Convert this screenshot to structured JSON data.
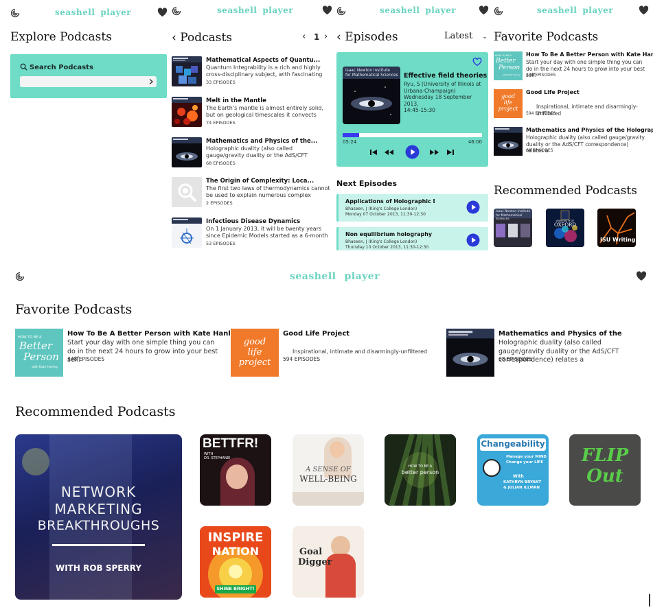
{
  "brand": {
    "part1": "seashell",
    "part2": "player"
  },
  "explore": {
    "title": "Explore Podcasts",
    "search_label": "Search Podcasts",
    "search_placeholder": ""
  },
  "podcasts": {
    "title": "Podcasts",
    "page": "1",
    "items": [
      {
        "title": "Mathematical Aspects of Quantu...",
        "desc": "Quantum Integrability is a rich and highly cross-disciplinary subject, with fascinating",
        "episodes": "33 EPISODES"
      },
      {
        "title": "Melt in the Mantle",
        "desc": "The Earth's mantle is almost entirely solid, but on geological timescales it convects vigorously, the",
        "episodes": "74 EPISODES"
      },
      {
        "title": "Mathematics and Physics of the...",
        "desc": "Holographic duality (also called gauge/gravity duality or the AdS/CFT correspondence) relates a",
        "episodes": "68 EPISODES"
      },
      {
        "title": "The Origin of Complexity: Loca...",
        "desc": "The first two laws of thermodynamics cannot be used to explain numerous complex phenomena",
        "episodes": "2 EPISODES"
      },
      {
        "title": "Infectious Disease Dynamics",
        "desc": "On 1 January 2013, it will be twenty years since Epidemic Models started as a 6-month",
        "episodes": "53 EPISODES"
      }
    ]
  },
  "episodes": {
    "title": "Episodes",
    "sort": "Latest",
    "art_line1": "Isaac Newton Institute",
    "art_line2": "for Mathematical Sciences",
    "current": {
      "title": "Effective field theories",
      "meta1": "Ryu, S (University of Illinois at",
      "meta2": "Urbana-Champaign)",
      "meta3": "Wednesday 18 September 2013,",
      "meta4": "14:45-15:30",
      "time_current": "05:24",
      "time_total": "46:00",
      "progress": 0.117
    },
    "next_title": "Next Episodes",
    "next": [
      {
        "title": "Applications of Holographic Du...",
        "meta1": "Bhaseen, J (King's College London)",
        "meta2": "Monday 07 October 2013, 11:30-12:30"
      },
      {
        "title": "Non equilibrium holography",
        "meta1": "Bhaseen, J (King's College London)",
        "meta2": "Thursday 10 October 2013, 11:30-12:30"
      }
    ]
  },
  "favorites": {
    "title": "Favorite Podcasts",
    "items": [
      {
        "title": "How To Be A Better Person with Kate Hanley",
        "desc": "Start your day with one simple thing you can do in the next 24 hours to grow into your best self.",
        "episodes": "348 EPISODES"
      },
      {
        "title": "Good Life Project",
        "desc": "Inspirational, intimate and disarmingly-unfiltered",
        "episodes": "594 EPISODES"
      },
      {
        "title": "Mathematics and Physics of the Holographic",
        "desc": "Holographic duality (also called gauge/gravity duality or the AdS/CFT correspondence) relates a",
        "episodes": "68 EPISODES"
      }
    ],
    "large_third_title": "Mathematics and Physics of the",
    "cover_text": {
      "better_1": "HOW TO BE A",
      "better_2": "Better",
      "better_3": "Person",
      "better_4": "with Kate Hanley",
      "goodlife": "good life project"
    }
  },
  "recommended": {
    "title": "Recommended Podcasts",
    "small": [
      {
        "name": "Isaac Newton Institute",
        "sub": "for Mathematical Sciences"
      },
      {
        "name": "UNIVERSITY OF",
        "sub": "OXFORD"
      },
      {
        "name": "ISU Writing",
        "sub": ""
      }
    ],
    "large": [
      {
        "line1": "NETWORK",
        "line2": "MARKETING",
        "line3": "BREAKTHROUGHS",
        "line4": "WITH ROB SPERRY"
      },
      {
        "line1": "BETTFR!",
        "line2": "WITH",
        "line3": "DR. STEPHANIE"
      },
      {
        "line1": "A SENSE OF",
        "line2": "WELL-BEING"
      },
      {
        "line1": "HOW TO BE A",
        "line2": "better person"
      },
      {
        "line1": "Changeability",
        "line2": "Manage your MIND",
        "line3": "Change your LIFE",
        "line4": "With",
        "line5": "KATHRYN BRYANT",
        "line6": "& JULIAN ILLMAN"
      },
      {
        "line1": "FLIP",
        "line2": "Out"
      },
      {
        "line1": "INSPIRE",
        "line2": "NATION",
        "line3": "SHINE BRIGHT!"
      },
      {
        "line1": "Goal",
        "line2": "Digger"
      }
    ]
  }
}
